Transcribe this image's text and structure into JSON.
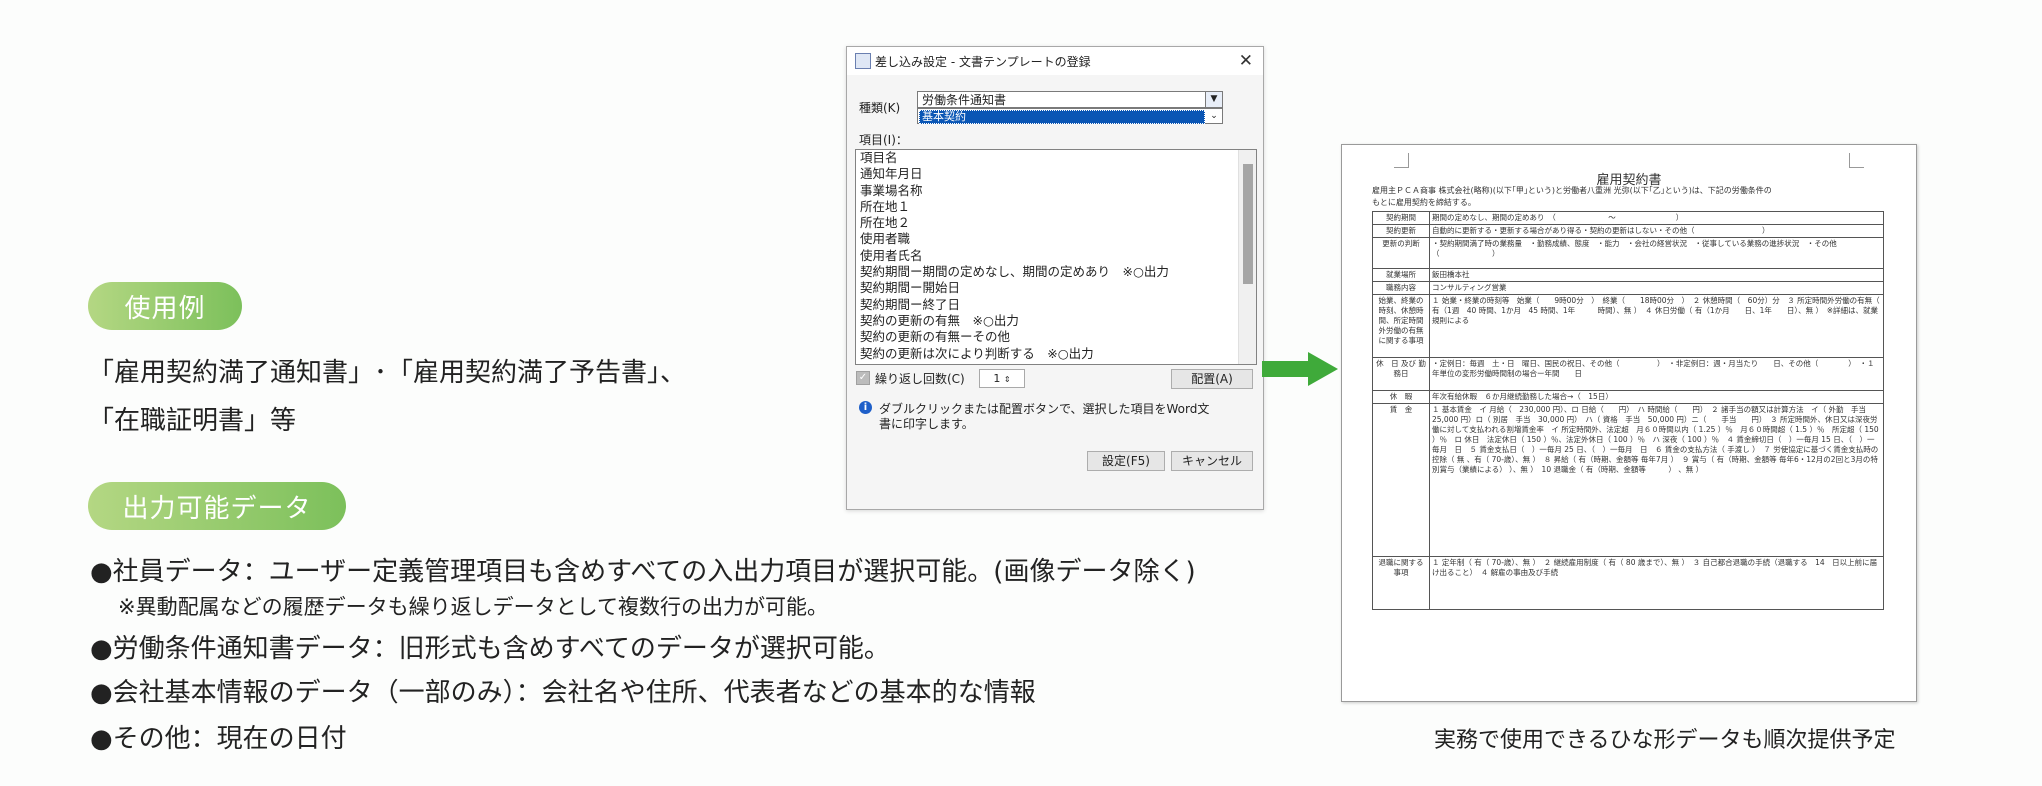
{
  "left": {
    "usage_pill": "使用例",
    "usage_line1": "「雇用契約満了通知書」･「雇用契約満了予告書」、",
    "usage_line2": "「在職証明書」等",
    "output_pill": "出力可能データ",
    "bullets": [
      "●社員データ：ユーザー定義管理項目も含めすべての入出力項目が選択可能。(画像データ除く)",
      "●労働条件通知書データ：旧形式も含めすべてのデータが選択可能。",
      "●会社基本情報のデータ（一部のみ）：会社名や住所、代表者などの基本的な情報",
      "●その他：現在の日付"
    ],
    "note": "※異動配属などの履歴データも繰り返しデータとして複数行の出力が可能。"
  },
  "dialog": {
    "title": "差し込み設定 - 文書テンプレートの登録",
    "type_label": "種類(K)",
    "type_value": "労働条件通知書",
    "type_selected": "基本契約",
    "items_label": "項目(I)：",
    "items": [
      "項目名",
      "通知年月日",
      "事業場名称",
      "所在地１",
      "所在地２",
      "使用者職",
      "使用者氏名",
      "契約期間ー期間の定めなし、期間の定めあり　※○出力",
      "契約期間ー開始日",
      "契約期間ー終了日",
      "契約の更新の有無　※○出力",
      "契約の更新の有無ーその他",
      "契約の更新は次により判断する　※○出力"
    ],
    "repeat_label": "繰り返し回数(C)",
    "repeat_value": "1",
    "place_button": "配置(A)",
    "info_text_1": "ダブルクリックまたは配置ボタンで、選択した項目をWord文",
    "info_text_2": "書に印字します。",
    "ok_button": "設定(F5)",
    "cancel_button": "キャンセル"
  },
  "document": {
    "title": "雇用契約書",
    "intro_1": "雇用主ＰＣＡ商事 株式会社(略称)(以下｢甲｣という)と労働者八重洲 光弥(以下｢乙｣という)は、下記の労働条件の",
    "intro_2": "もとに雇用契約を締結する。",
    "rows": [
      {
        "h": "契約期間",
        "c": "期間の定めなし、期間の定めあり　（　　　　　　　〜　　　　　　　　）"
      },
      {
        "h": "契約更新",
        "c": "自動的に更新する・更新する場合があり得る・契約の更新はしない・その他（　　　　　　　　　）"
      },
      {
        "h": "更新の判断",
        "c": "・契約期間満了時の業務量　・勤務成績、態度　・能力　・会社の経営状況　・従事している業務の進捗状況　・その他（　　　　　　　）"
      },
      {
        "h": "就業場所",
        "c": "飯田橋本社"
      },
      {
        "h": "職務内容",
        "c": "コンサルティング営業"
      },
      {
        "h": "始業、終業の時刻、休憩時間、所定時間外労働の有無に関する事項",
        "c": "１ 始業・終業の時刻等　始業（　　9時00分　）　終業（　　18時00分　）　２ 休憩時間（　60分）分　３ 所定時間外労働の有無（ 有（1週　40 時間、1か月　45 時間、1年　　　時間）、無 ）　４ 休日労働（ 有（1か月　　日、1年　　日）、無 ）　※詳細は、就業規則による"
      },
      {
        "h": "休　日 及び 勤務日",
        "c": "・定例日：毎週　土・日　曜日、国民の祝日、その他（　　　　　）　・非定例日：週・月当たり　　日、その他（　　　　）　・１年単位の変形労働時間制の場合ー年間　　日"
      },
      {
        "h": "休　暇",
        "c": "年次有給休暇　６か月継続勤務した場合→（　15日）"
      },
      {
        "h": "賃　金",
        "c": "１ 基本賃金　イ 月給（　230,000 円）、ロ 日給（　　円）　ハ 時間給（　　円）　２ 諸手当の額又は計算方法　イ（ 外勤　手当　25,000 円）ロ（ 別居　手当　30,000 円）　ハ（ 資格　手当　50,000 円）ニ（　　手当　　円）　３ 所定時間外、休日又は深夜労働に対して支払われる割増賃金率　イ 所定時間外、法定超　月６０時間以内（ 1.25 ）％　月６０時間超（ 1.5 ）％　所定超（ 150 ）％　ロ 休日　法定休日（ 150 ）％、法定外休日（ 100 ）％　ハ 深夜（ 100 ）％　４ 賃金締切日（　）一毎月 15 日、（　）一毎月　日　５ 賃金支払日（　）一毎月 25 日、（　）一毎月　日　６ 賃金の支払方法（ 手渡し ）　７ 労使協定に基づく賃金支払時の控除（ 無 、有（ 70-歳）、無 ）　８ 昇給（ 有（時期、金額等 毎年7月 ）　９ 賞与（ 有（時期、金額等 毎年6・12月の2回と3月の特別賞与（業績による） ）、無 ）　10 退職金（ 有（時期、金額等　　　） 、無 ）"
      },
      {
        "h": "退職に関する事項",
        "c": "１ 定年制（ 有（ 70-歳）、無 ）　２ 継続雇用制度（ 有（ 80 歳まで）、無 ）　３ 自己都合退職の手続（退職する　14　日以上前に届け出ること）　４ 解雇の事由及び手続"
      }
    ]
  },
  "caption": "実務で使用できるひな形データも順次提供予定",
  "colors": {
    "pill_start": "#b4d783",
    "pill_end": "#7cc05b",
    "arrow": "#3faa3a",
    "selection": "#0a56b5"
  }
}
